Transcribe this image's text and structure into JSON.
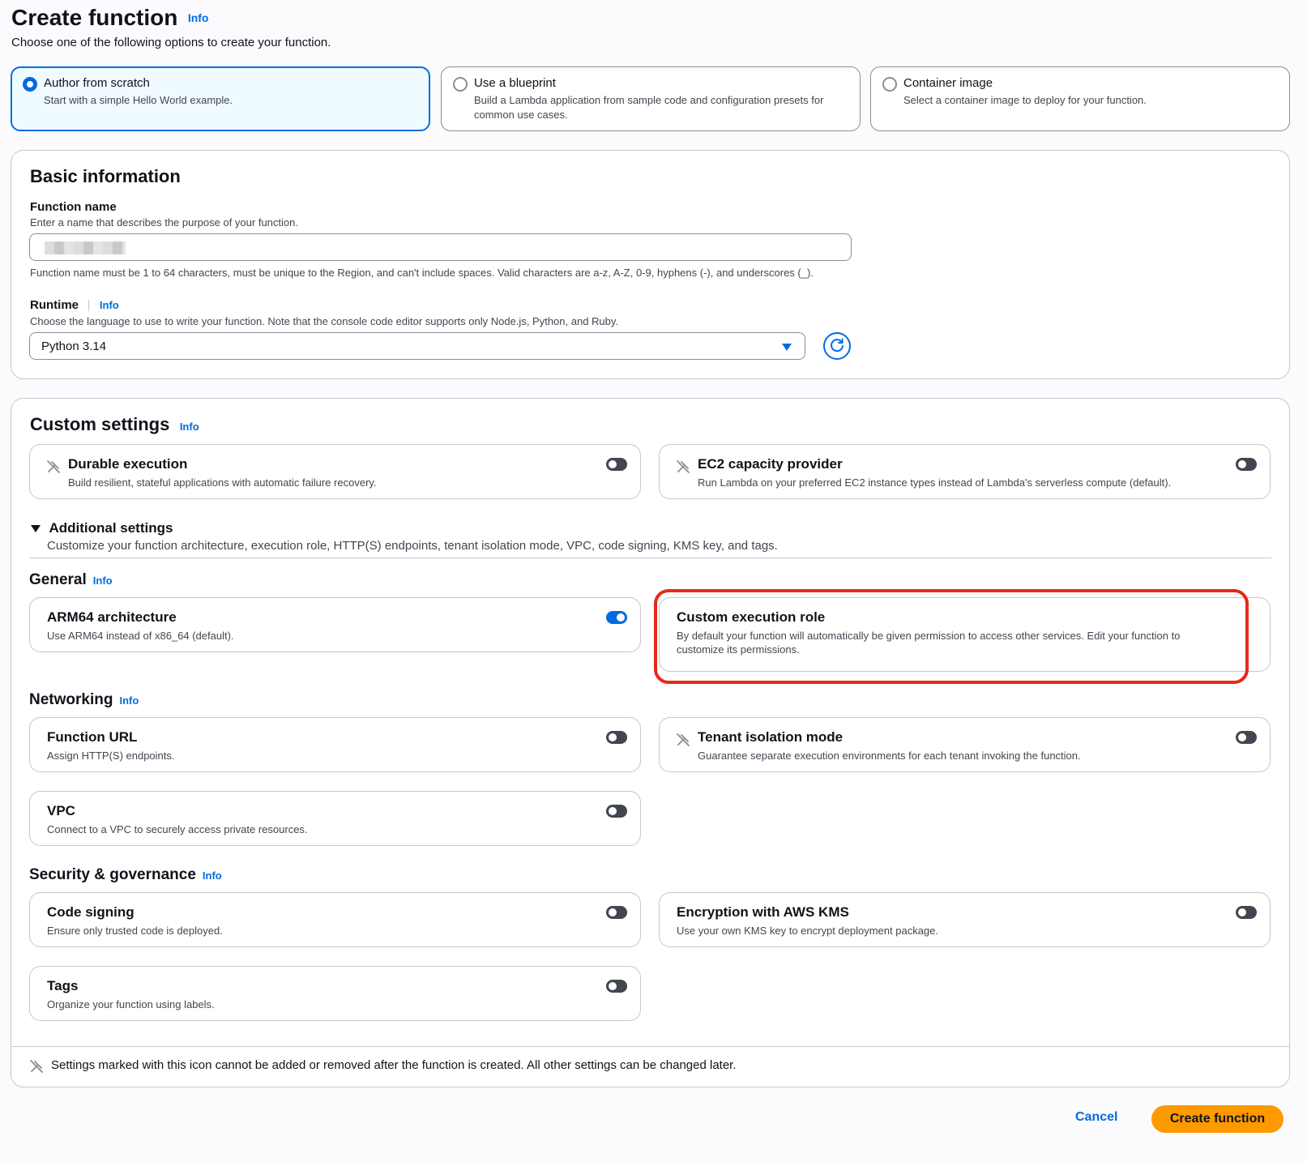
{
  "header": {
    "title": "Create function",
    "info": "Info",
    "description": "Choose one of the following options to create your function."
  },
  "options": [
    {
      "title": "Author from scratch",
      "description": "Start with a simple Hello World example.",
      "selected": true
    },
    {
      "title": "Use a blueprint",
      "description": "Build a Lambda application from sample code and configuration presets for common use cases.",
      "selected": false
    },
    {
      "title": "Container image",
      "description": "Select a container image to deploy for your function.",
      "selected": false
    }
  ],
  "basic": {
    "heading": "Basic information",
    "function_name_label": "Function name",
    "function_name_desc": "Enter a name that describes the purpose of your function.",
    "function_name_constraint": "Function name must be 1 to 64 characters, must be unique to the Region, and can't include spaces. Valid characters are a-z, A-Z, 0-9, hyphens (-), and underscores (_).",
    "runtime_label": "Runtime",
    "runtime_info": "Info",
    "runtime_desc": "Choose the language to use to write your function. Note that the console code editor supports only Node.js, Python, and Ruby.",
    "runtime_value": "Python 3.14"
  },
  "custom": {
    "heading": "Custom settings",
    "info": "Info",
    "durable": {
      "title": "Durable execution",
      "desc": "Build resilient, stateful applications with automatic failure recovery.",
      "on": false
    },
    "ec2": {
      "title": "EC2 capacity provider",
      "desc": "Run Lambda on your preferred EC2 instance types instead of Lambda's serverless compute (default).",
      "on": false
    },
    "additional_title": "Additional settings",
    "additional_desc": "Customize your function architecture, execution role, HTTP(S) endpoints, tenant isolation mode, VPC, code signing, KMS key, and tags."
  },
  "general": {
    "heading": "General",
    "info": "Info",
    "arm64": {
      "title": "ARM64 architecture",
      "desc": "Use ARM64 instead of x86_64 (default).",
      "on": true
    },
    "role": {
      "title": "Custom execution role",
      "desc": "By default your function will automatically be given permission to access other services. Edit your function to customize its permissions."
    }
  },
  "networking": {
    "heading": "Networking",
    "info": "Info",
    "url": {
      "title": "Function URL",
      "desc": "Assign HTTP(S) endpoints.",
      "on": false
    },
    "tenant": {
      "title": "Tenant isolation mode",
      "desc": "Guarantee separate execution environments for each tenant invoking the function.",
      "on": false
    },
    "vpc": {
      "title": "VPC",
      "desc": "Connect to a VPC to securely access private resources.",
      "on": false
    }
  },
  "security": {
    "heading": "Security & governance",
    "info": "Info",
    "signing": {
      "title": "Code signing",
      "desc": "Ensure only trusted code is deployed.",
      "on": false
    },
    "kms": {
      "title": "Encryption with AWS KMS",
      "desc": "Use your own KMS key to encrypt deployment package.",
      "on": false
    },
    "tags": {
      "title": "Tags",
      "desc": "Organize your function using labels.",
      "on": false
    }
  },
  "footer_note": "Settings marked with this icon cannot be added or removed after the function is created. All other settings can be changed later.",
  "actions": {
    "cancel": "Cancel",
    "create": "Create function"
  },
  "colors": {
    "accent": "#006ce0",
    "primary_button": "#ff9900",
    "highlight": "#e8281a"
  }
}
